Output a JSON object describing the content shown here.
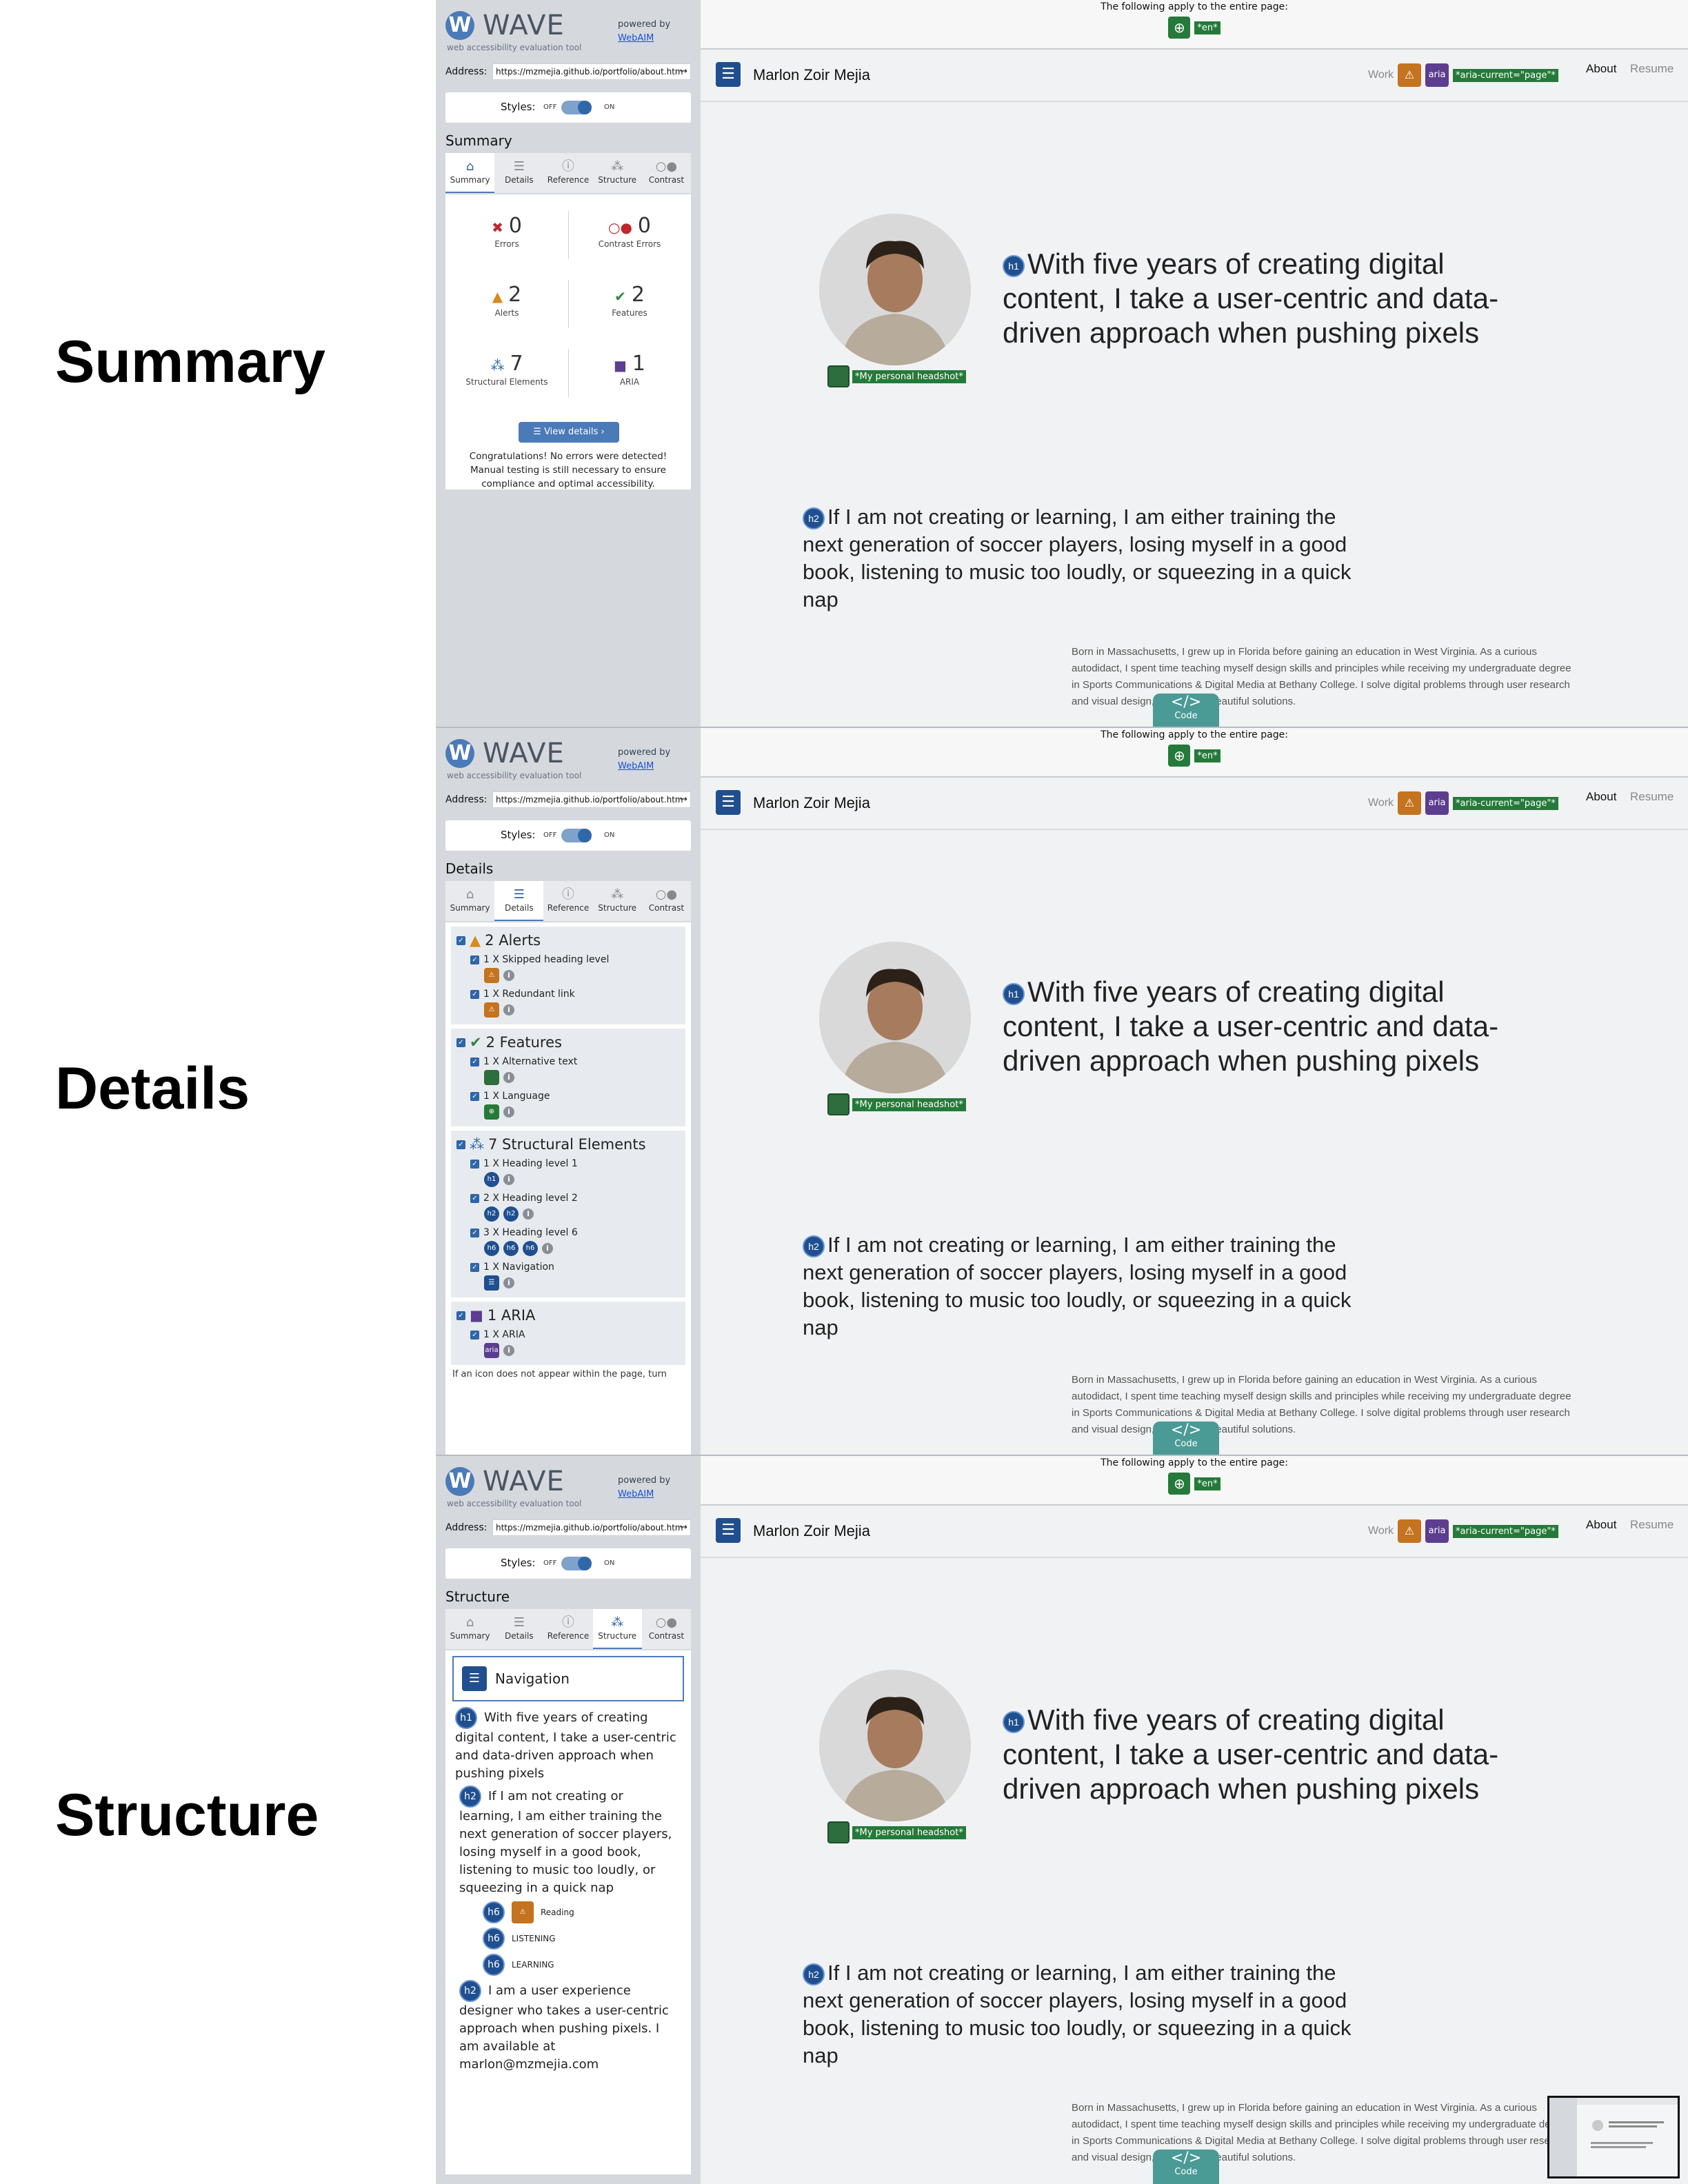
{
  "labels": {
    "summary": "Summary",
    "details": "Details",
    "structure": "Structure"
  },
  "wave": {
    "logo_letter": "W",
    "title": "WAVE",
    "tagline": "web accessibility evaluation tool",
    "powered_by": "powered by",
    "webaim": "WebAIM",
    "address_label": "Address:",
    "address": "https://mzmejia.github.io/portfolio/about.htm",
    "styles_label": "Styles:",
    "off": "OFF",
    "on": "ON"
  },
  "tabs": [
    {
      "label": "Summary",
      "icon": "home-icon",
      "glyph": "⌂"
    },
    {
      "label": "Details",
      "icon": "list-icon",
      "glyph": "☰"
    },
    {
      "label": "Reference",
      "icon": "info-icon",
      "glyph": "ⓘ"
    },
    {
      "label": "Structure",
      "icon": "structure-icon",
      "glyph": "⁂"
    },
    {
      "label": "Contrast",
      "icon": "contrast-icon",
      "glyph": "○●"
    }
  ],
  "summary": {
    "errors": {
      "count": "0",
      "label": "Errors"
    },
    "contrast": {
      "count": "0",
      "label": "Contrast Errors"
    },
    "alerts": {
      "count": "2",
      "label": "Alerts"
    },
    "features": {
      "count": "2",
      "label": "Features"
    },
    "structural": {
      "count": "7",
      "label": "Structural Elements"
    },
    "aria": {
      "count": "1",
      "label": "ARIA"
    },
    "view_details": "View details ›",
    "congrats": "Congratulations! No errors were detected! Manual testing is still necessary to ensure compliance and optimal accessibility."
  },
  "details": {
    "alerts": {
      "heading": "2 Alerts",
      "items": [
        "1 X Skipped heading level",
        "1 X Redundant link"
      ]
    },
    "features": {
      "heading": "2 Features",
      "items": [
        "1 X Alternative text",
        "1 X Language"
      ]
    },
    "structural": {
      "heading": "7 Structural Elements",
      "items": [
        "1 X Heading level 1",
        "2 X Heading level 2",
        "3 X Heading level 6",
        "1 X Navigation"
      ]
    },
    "aria": {
      "heading": "1 ARIA",
      "items": [
        "1 X ARIA"
      ]
    },
    "note": "If an icon does not appear within the page, turn"
  },
  "structure": {
    "nav": "Navigation",
    "h1": "With five years of creating digital content, I take a user-centric and data-driven approach when pushing pixels",
    "h2a": "If I am not creating or learning, I am either training the next generation of soccer players, losing myself in a good book, listening to music too loudly, or squeezing in a quick nap",
    "h6": [
      "Reading",
      "LISTENING",
      "LEARNING"
    ],
    "h2b": "I am a user experience designer who takes a user-centric approach when pushing pixels. I am available at marlon@mzmejia.com"
  },
  "page": {
    "banner": "The following apply to the entire page:",
    "lang_tag": "*en*",
    "brand": "Marlon Zoir Mejia",
    "work": "Work",
    "aria_label": "aria",
    "aria_current": "*aria-current=\"page\"*",
    "about": "About",
    "resume": "Resume",
    "alt_text": "*My personal headshot*",
    "h1": "With five years of creating digital content, I take a user-centric and data-driven approach when pushing pixels",
    "h2": "If I am not creating or learning, I am either training the next generation of soccer players, losing myself in a good book, listening to music too loudly, or squeezing in a quick nap",
    "para": "Born in Massachusetts, I grew up in Florida before gaining an education in West Virginia. As a curious autodidact, I spent time teaching myself design skills and principles while receiving my undergraduate degree in Sports Communications & Digital Media at Bethany College. I solve digital problems through user research and visual design, resulting in beautiful solutions.",
    "code": "Code",
    "h1_badge": "h1",
    "h2_badge": "h2",
    "h6_badge": "h6"
  }
}
